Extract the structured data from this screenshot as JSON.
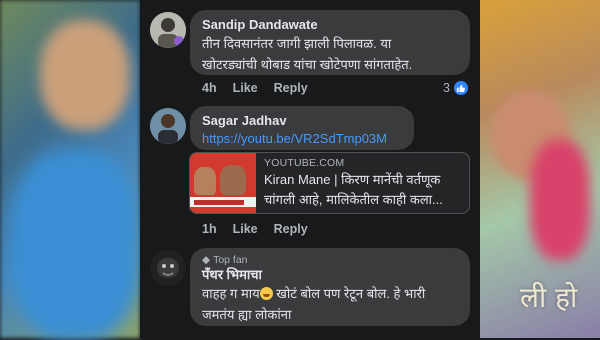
{
  "background_right": {
    "watermark": "ली हो"
  },
  "comments": [
    {
      "author": "Sandip Dandawate",
      "lines": [
        "तीन दिवसानंतर जागी झाली पिलावळ. या",
        "खोटरड्यांची थोबाड यांचा खोटेपणा सांगताहेत."
      ],
      "time": "4h",
      "like_label": "Like",
      "reply_label": "Reply",
      "reaction_count": "3",
      "reaction_icon": "like-icon"
    },
    {
      "author": "Sagar Jadhav",
      "link": "https://youtu.be/VR2SdTmp03M",
      "preview": {
        "domain": "YOUTUBE.COM",
        "title_lines": [
          "Kiran Mane | किरण मानेंची वर्तणूक",
          "चांगली आहे, मालिकेतील काही कला..."
        ]
      },
      "time": "1h",
      "like_label": "Like",
      "reply_label": "Reply"
    },
    {
      "badge": "Top fan",
      "author": "पॅंथर भिमाचा",
      "line1_before": "वाहह ग माय",
      "line1_after": " खोटं बोल पण रेटून बोल. हे भारी",
      "line2": "जमतंय ह्या लोकांना"
    }
  ],
  "colors": {
    "link": "#4599ff",
    "bubble": "#3a3b3c",
    "background": "#18191a"
  }
}
